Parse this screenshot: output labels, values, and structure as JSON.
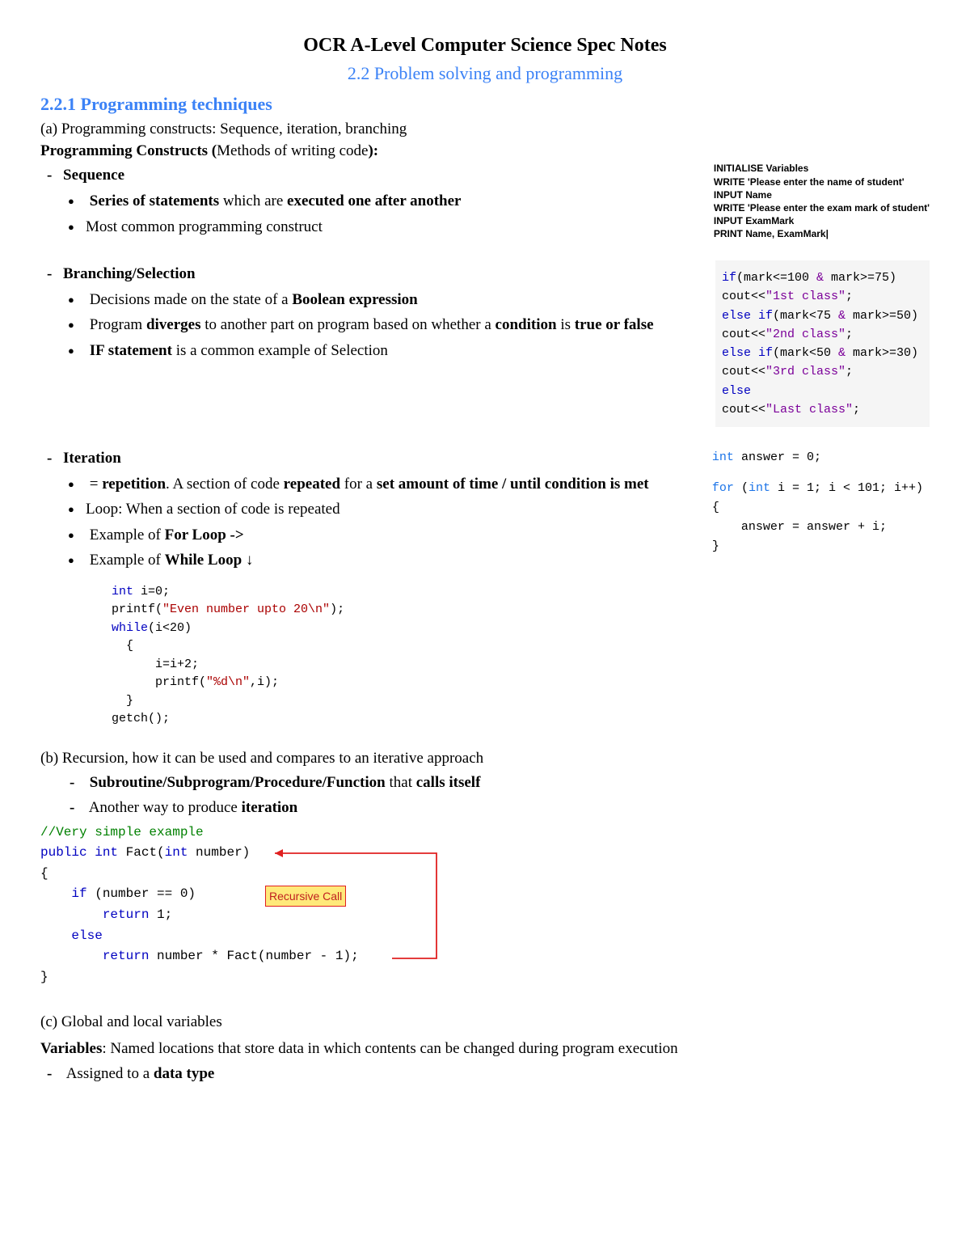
{
  "header": {
    "title": "OCR A-Level Computer Science Spec Notes",
    "subtitle": "2.2 Problem solving and programming"
  },
  "s221": {
    "heading": "2.2.1 Programming techniques",
    "a_line": "(a) Programming constructs: Sequence, iteration, branching",
    "pc_label_b": "Programming Constructs (",
    "pc_label_r": "Methods of writing code",
    "pc_label_c": "):",
    "sequence": {
      "title": "Sequence",
      "b1_a": "Series of statements",
      "b1_b": " which are ",
      "b1_c": "executed one after another",
      "b2": "Most common programming construct",
      "aside": {
        "l1": "INITIALISE Variables",
        "l2": "WRITE 'Please enter the name of student'",
        "l3": "INPUT Name",
        "l4": "WRITE 'Please enter the exam mark of student'",
        "l5": "INPUT ExamMark",
        "l6": "PRINT Name, ExamMark|"
      }
    },
    "branching": {
      "title": "Branching/Selection",
      "b1_a": "Decisions made on the state of a ",
      "b1_b": "Boolean expression",
      "b2_a": "Program ",
      "b2_b": "diverges",
      "b2_c": " to another part on program based on whether a ",
      "b2_d": "condition",
      "b2_e": " is ",
      "b2_f": "true or false",
      "b3_a": "IF statement",
      "b3_b": " is a common example of Selection",
      "code": {
        "l1a": "if",
        "l1b": "(mark<=100 ",
        "l1c": "&",
        "l1d": " mark>=75)",
        "l2a": "cout<<",
        "l2b": "\"1st class\"",
        "l2c": ";",
        "l3a": "else if",
        "l3b": "(mark<75 ",
        "l3c": "&",
        "l3d": " mark>=50)",
        "l4a": "cout<<",
        "l4b": "\"2nd class\"",
        "l4c": ";",
        "l5a": "else if",
        "l5b": "(mark<50 ",
        "l5c": "&",
        "l5d": " mark>=30)",
        "l6a": "cout<<",
        "l6b": "\"3rd class\"",
        "l6c": ";",
        "l7": "else",
        "l8a": "cout<<",
        "l8b": "\"Last class\"",
        "l8c": ";"
      }
    },
    "iteration": {
      "title": "Iteration",
      "b1_a": "= ",
      "b1_b": "repetition",
      "b1_c": ". A section of code ",
      "b1_d": "repeated",
      "b1_e": " for a ",
      "b1_f": "set amount of time / until condition is met",
      "b2": "Loop: When a section of code is repeated",
      "b3_a": "Example of ",
      "b3_b": "For Loop ->",
      "b4_a": "Example of ",
      "b4_b": "While Loop",
      "b4_c": " ↓",
      "for_code": {
        "l1a": "int",
        "l1b": " answer = 0;",
        "l2a": "for",
        "l2b": " (",
        "l2c": "int",
        "l2d": " i = 1; i < 101; i++)",
        "l3": "{",
        "l4": "    answer = answer + i;",
        "l5": "}"
      },
      "while_code": {
        "l1a": "int",
        "l1b": " i=0;",
        "l2a": "printf(",
        "l2b": "\"Even number upto 20\\n\"",
        "l2c": ");",
        "l3a": "while",
        "l3b": "(i<20)",
        "l4": "  {",
        "l5": "      i=i+2;",
        "l6a": "      printf(",
        "l6b": "\"%d\\n\"",
        "l6c": ",i);",
        "l7": "  }",
        "l8": "getch();"
      }
    }
  },
  "sb": {
    "line": "(b) Recursion, how it can be used and compares to an iterative approach",
    "d1_a": "Subroutine/Subprogram/Procedure/Function",
    "d1_b": " that ",
    "d1_c": "calls itself",
    "d2_a": "Another way to produce ",
    "d2_b": "iteration",
    "code": {
      "l1": "//Very simple example",
      "l2a": "public",
      "l2b": " ",
      "l2c": "int",
      "l2d": " Fact(",
      "l2e": "int",
      "l2f": " number)",
      "l3": "{",
      "l4a": "    ",
      "l4b": "if",
      "l4c": " (number == 0)",
      "l5a": "        ",
      "l5b": "return",
      "l5c": " 1;",
      "l6a": "    ",
      "l6b": "else",
      "l7a": "        ",
      "l7b": "return",
      "l7c": " number * Fact(number - 1);",
      "l8": "}",
      "label": "Recursive Call"
    }
  },
  "sc": {
    "line": "(c) Global and local variables",
    "var_a": "Variables",
    "var_b": ": Named locations that store data in which contents can be changed during program execution",
    "d1_a": "Assigned to a ",
    "d1_b": "data type"
  }
}
